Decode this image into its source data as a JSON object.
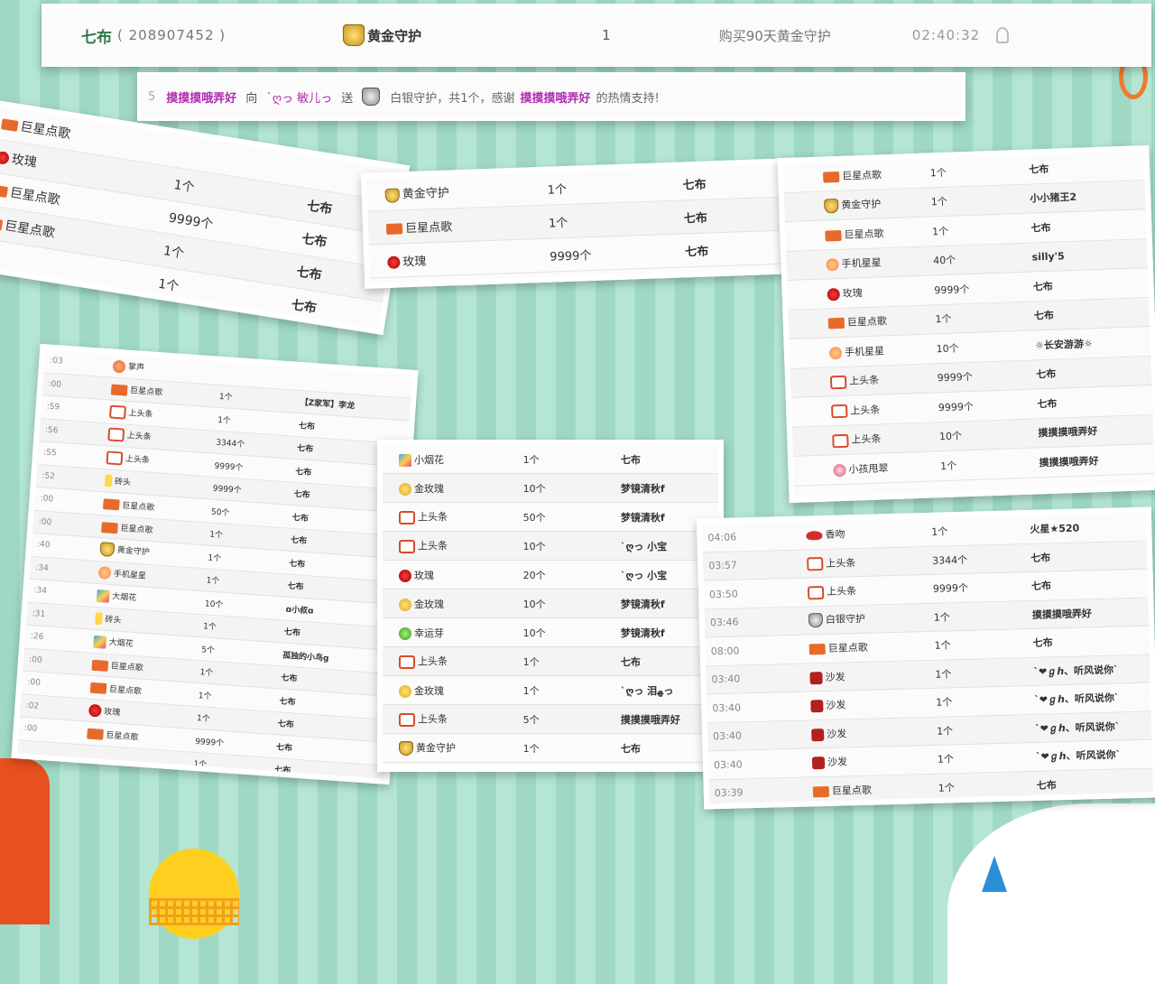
{
  "header": {
    "name": "七布",
    "id_text": "( 208907452 )",
    "gift": "黄金守护",
    "count": "1",
    "desc": "购买90天黄金守护",
    "time": "02:40:32"
  },
  "banner": {
    "lead": "5",
    "user1": "摸摸摸哦弄好",
    "w_to": "向",
    "user2": "ˋღっ 敏儿っ",
    "w_send": "送",
    "gift": "白银守护，共1个，感谢",
    "user3": "摸摸摸哦弄好",
    "tail": "的热情支持!"
  },
  "card_a": {
    "rows": [
      {
        "gift": "巨星点歌",
        "icon": "song-icon",
        "count": "",
        "user": ""
      },
      {
        "gift": "玫瑰",
        "icon": "rose-icon",
        "count": "1个",
        "user": "七布"
      },
      {
        "gift": "巨星点歌",
        "icon": "song-icon",
        "count": "9999个",
        "user": "七布"
      },
      {
        "gift": "巨星点歌",
        "icon": "song-icon",
        "count": "1个",
        "user": "七布"
      },
      {
        "gift": "",
        "icon": "",
        "count": "1个",
        "user": "七布"
      }
    ]
  },
  "card_b": {
    "rows": [
      {
        "gift": "黄金守护",
        "icon": "gold-guard-icon",
        "count": "1个",
        "user": "七布"
      },
      {
        "gift": "巨星点歌",
        "icon": "song-icon",
        "count": "1个",
        "user": "七布"
      },
      {
        "gift": "玫瑰",
        "icon": "rose-icon",
        "count": "9999个",
        "user": "七布"
      }
    ]
  },
  "card_c": {
    "rows": [
      {
        "gift": "巨星点歌",
        "icon": "song-icon",
        "count": "1个",
        "user": "七布"
      },
      {
        "gift": "黄金守护",
        "icon": "gold-guard-icon",
        "count": "1个",
        "user": "小小猪王2"
      },
      {
        "gift": "巨星点歌",
        "icon": "song-icon",
        "count": "1个",
        "user": "七布"
      },
      {
        "gift": "手机星星",
        "icon": "phone-star-icon",
        "count": "40个",
        "user": "silly'5"
      },
      {
        "gift": "玫瑰",
        "icon": "rose-icon",
        "count": "9999个",
        "user": "七布"
      },
      {
        "gift": "巨星点歌",
        "icon": "song-icon",
        "count": "1个",
        "user": "七布"
      },
      {
        "gift": "手机星星",
        "icon": "phone-star-icon",
        "count": "10个",
        "user": "☼长安游游☼"
      },
      {
        "gift": "上头条",
        "icon": "headline-icon",
        "count": "9999个",
        "user": "七布"
      },
      {
        "gift": "上头条",
        "icon": "headline-icon",
        "count": "9999个",
        "user": "七布"
      },
      {
        "gift": "上头条",
        "icon": "headline-icon",
        "count": "10个",
        "user": "摸摸摸哦弄好"
      },
      {
        "gift": "小孩甩翠",
        "icon": "kid-icon",
        "count": "1个",
        "user": "摸摸摸哦弄好"
      }
    ]
  },
  "card_d": {
    "rows": [
      {
        "time": ":03",
        "gift": "掌声",
        "icon": "clap-icon",
        "count": "",
        "user": ""
      },
      {
        "time": ":00",
        "gift": "巨星点歌",
        "icon": "song-icon",
        "count": "1个",
        "user": "【Z家军】李龙"
      },
      {
        "time": ":59",
        "gift": "上头条",
        "icon": "headline-icon",
        "count": "1个",
        "user": "七布"
      },
      {
        "time": ":56",
        "gift": "上头条",
        "icon": "headline-icon",
        "count": "3344个",
        "user": "七布"
      },
      {
        "time": ":55",
        "gift": "上头条",
        "icon": "headline-icon",
        "count": "9999个",
        "user": "七布"
      },
      {
        "time": ":52",
        "gift": "砖头",
        "icon": "brick-icon",
        "count": "9999个",
        "user": "七布"
      },
      {
        "time": ":00",
        "gift": "巨星点歌",
        "icon": "song-icon",
        "count": "50个",
        "user": "七布"
      },
      {
        "time": ":00",
        "gift": "巨星点歌",
        "icon": "song-icon",
        "count": "1个",
        "user": "七布"
      },
      {
        "time": ":40",
        "gift": "黄金守护",
        "icon": "gold-guard-icon",
        "count": "1个",
        "user": "七布"
      },
      {
        "time": ":34",
        "gift": "手机星星",
        "icon": "phone-star-icon",
        "count": "1个",
        "user": "七布"
      },
      {
        "time": ":34",
        "gift": "大烟花",
        "icon": "firework-icon",
        "count": "10个",
        "user": "ɑ小叔ɑ"
      },
      {
        "time": ":31",
        "gift": "砖头",
        "icon": "brick-icon",
        "count": "1个",
        "user": "七布"
      },
      {
        "time": ":26",
        "gift": "大烟花",
        "icon": "firework-icon",
        "count": "5个",
        "user": "孤独的小鸟g"
      },
      {
        "time": ":00",
        "gift": "巨星点歌",
        "icon": "song-icon",
        "count": "1个",
        "user": "七布"
      },
      {
        "time": ":00",
        "gift": "巨星点歌",
        "icon": "song-icon",
        "count": "1个",
        "user": "七布"
      },
      {
        "time": ":02",
        "gift": "玫瑰",
        "icon": "rose-icon",
        "count": "1个",
        "user": "七布"
      },
      {
        "time": ":00",
        "gift": "巨星点歌",
        "icon": "song-icon",
        "count": "9999个",
        "user": "七布"
      },
      {
        "time": "",
        "gift": "",
        "icon": "",
        "count": "1个",
        "user": "七布"
      }
    ]
  },
  "card_e": {
    "rows": [
      {
        "gift": "小烟花",
        "icon": "small-firework-icon",
        "count": "1个",
        "user": "七布"
      },
      {
        "gift": "金玫瑰",
        "icon": "gold-rose-icon",
        "count": "10个",
        "user": "梦镜清秋f"
      },
      {
        "gift": "上头条",
        "icon": "headline-icon",
        "count": "50个",
        "user": "梦镜清秋f"
      },
      {
        "gift": "上头条",
        "icon": "headline-icon",
        "count": "10个",
        "user": "ˋღっ 小宝"
      },
      {
        "gift": "玫瑰",
        "icon": "rose-icon",
        "count": "20个",
        "user": "ˋღっ 小宝"
      },
      {
        "gift": "金玫瑰",
        "icon": "gold-rose-icon",
        "count": "10个",
        "user": "梦镜清秋f"
      },
      {
        "gift": "幸运芽",
        "icon": "lucky-sprout-icon",
        "count": "10个",
        "user": "梦镜清秋f"
      },
      {
        "gift": "上头条",
        "icon": "headline-icon",
        "count": "1个",
        "user": "七布"
      },
      {
        "gift": "金玫瑰",
        "icon": "gold-rose-icon",
        "count": "1个",
        "user": "ˋღっ 泪ﻬっ"
      },
      {
        "gift": "上头条",
        "icon": "headline-icon",
        "count": "5个",
        "user": "摸摸摸哦弄好"
      },
      {
        "gift": "黄金守护",
        "icon": "gold-guard-icon",
        "count": "1个",
        "user": "七布"
      }
    ]
  },
  "card_f": {
    "rows": [
      {
        "time": "04:06",
        "gift": "香吻",
        "icon": "kiss-icon",
        "count": "1个",
        "user": "火星★520"
      },
      {
        "time": "03:57",
        "gift": "上头条",
        "icon": "headline-icon",
        "count": "3344个",
        "user": "七布"
      },
      {
        "time": "03:50",
        "gift": "上头条",
        "icon": "headline-icon",
        "count": "9999个",
        "user": "七布"
      },
      {
        "time": "03:46",
        "gift": "白银守护",
        "icon": "silver-guard-icon",
        "count": "1个",
        "user": "摸摸摸哦弄好"
      },
      {
        "time": "08:00",
        "gift": "巨星点歌",
        "icon": "song-icon",
        "count": "1个",
        "user": "七布"
      },
      {
        "time": "03:40",
        "gift": "沙发",
        "icon": "sofa-icon",
        "count": "1个",
        "user": "ˋ❤ℊℎ、听风说你ˋ"
      },
      {
        "time": "03:40",
        "gift": "沙发",
        "icon": "sofa-icon",
        "count": "1个",
        "user": "ˋ❤ℊℎ、听风说你ˋ"
      },
      {
        "time": "03:40",
        "gift": "沙发",
        "icon": "sofa-icon",
        "count": "1个",
        "user": "ˋ❤ℊℎ、听风说你ˋ"
      },
      {
        "time": "03:40",
        "gift": "沙发",
        "icon": "sofa-icon",
        "count": "1个",
        "user": "ˋ❤ℊℎ、听风说你ˋ"
      },
      {
        "time": "03:39",
        "gift": "巨星点歌",
        "icon": "song-icon",
        "count": "1个",
        "user": "七布"
      }
    ]
  }
}
